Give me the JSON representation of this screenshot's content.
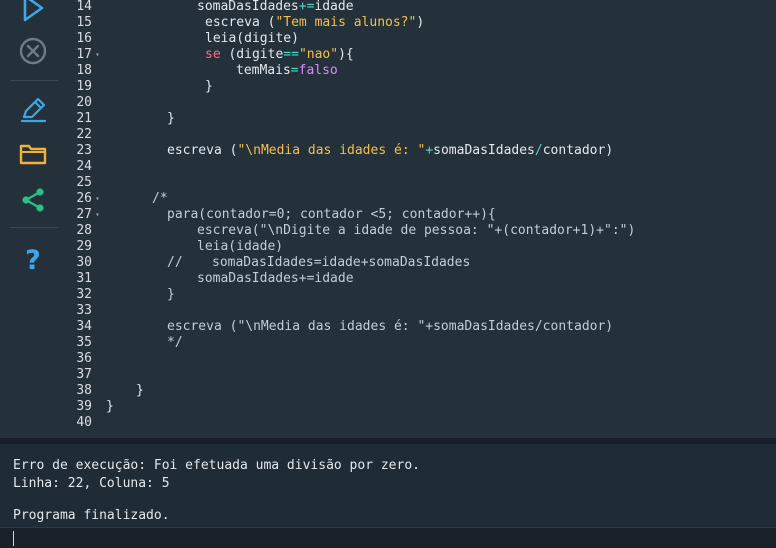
{
  "sidebar": {
    "run": "play-icon",
    "stop": "stop-icon",
    "edit": "pencil-icon",
    "files": "folder-icon",
    "share": "share-icon",
    "help": "help-icon",
    "help_text": "?"
  },
  "code_lines": [
    {
      "num": "14",
      "fold": ""
    },
    {
      "num": "15",
      "fold": ""
    },
    {
      "num": "16",
      "fold": ""
    },
    {
      "num": "17",
      "fold": "▾"
    },
    {
      "num": "18",
      "fold": ""
    },
    {
      "num": "19",
      "fold": ""
    },
    {
      "num": "20",
      "fold": ""
    },
    {
      "num": "21",
      "fold": ""
    },
    {
      "num": "22",
      "fold": ""
    },
    {
      "num": "23",
      "fold": ""
    },
    {
      "num": "24",
      "fold": ""
    },
    {
      "num": "25",
      "fold": ""
    },
    {
      "num": "26",
      "fold": "▾"
    },
    {
      "num": "27",
      "fold": "▾"
    },
    {
      "num": "28",
      "fold": ""
    },
    {
      "num": "29",
      "fold": ""
    },
    {
      "num": "30",
      "fold": ""
    },
    {
      "num": "31",
      "fold": ""
    },
    {
      "num": "32",
      "fold": ""
    },
    {
      "num": "33",
      "fold": ""
    },
    {
      "num": "34",
      "fold": ""
    },
    {
      "num": "35",
      "fold": ""
    },
    {
      "num": "36",
      "fold": ""
    },
    {
      "num": "37",
      "fold": ""
    },
    {
      "num": "38",
      "fold": ""
    },
    {
      "num": "39",
      "fold": ""
    },
    {
      "num": "40",
      "fold": ""
    }
  ],
  "code": {
    "l14": {
      "a": "somaDasIdades",
      "b": "+=",
      "c": "idade"
    },
    "l15": {
      "a": "escreva (",
      "b": "\"Tem mais alunos?\"",
      "c": ")"
    },
    "l16": {
      "a": "leia(digite)"
    },
    "l17": {
      "a": "se",
      "b": " (digite",
      "c": "==",
      "d": "\"nao\"",
      "e": "){"
    },
    "l18": {
      "a": "temMais",
      "b": "=",
      "c": "falso"
    },
    "l19": {
      "a": "}"
    },
    "l21": {
      "a": "}"
    },
    "l23": {
      "a": "escreva (",
      "b": "\"\\n",
      "c": "Media das idades é: \"",
      "d": "+",
      "e": "somaDasIdades",
      "f": "/",
      "g": "contador)"
    },
    "l26": {
      "a": "/*"
    },
    "l27": {
      "a": "para(contador=0; contador <5; contador++){"
    },
    "l28": {
      "a": "escreva(\"\\nDigite a idade de pessoa: \"+(contador+1)+\":\")"
    },
    "l29": {
      "a": "leia(idade)"
    },
    "l30": {
      "a": "//",
      "b": "somaDasIdades=idade+somaDasIdades"
    },
    "l31": {
      "a": "somaDasIdades+=idade"
    },
    "l32": {
      "a": "}"
    },
    "l34": {
      "a": "escreva (\"\\nMedia das idades é: \"+somaDasIdades/contador)"
    },
    "l35": {
      "a": "*/"
    },
    "l38": {
      "a": "}"
    },
    "l39": {
      "a": "}"
    }
  },
  "console": {
    "error_line": "Erro de execução: Foi efetuada uma divisão por zero.",
    "position_line": "Linha: 22, Coluna: 5",
    "finished_line": "Programa finalizado."
  },
  "colors": {
    "string": "#f1c14d",
    "keyword": "#ff6e86",
    "boolean": "#d88cff",
    "operator": "#4fd7c8",
    "sidebar_icon": "#3fa7e8",
    "background": "#24303a"
  }
}
